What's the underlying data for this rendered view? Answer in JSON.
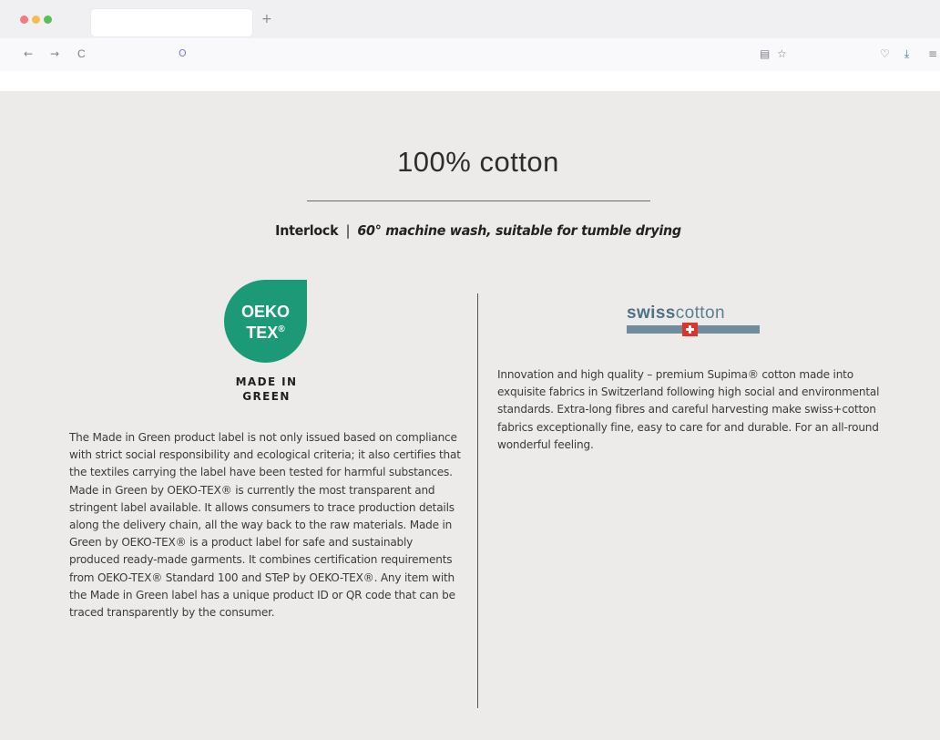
{
  "browser": {
    "new_tab_symbol": "+",
    "nav": {
      "back_icon": "←",
      "forward_icon": "→",
      "reload_icon": "C",
      "shield_icon": "O",
      "reader_icon": "▤",
      "bookmark_icon": "☆",
      "pocket_icon": "♡",
      "download_icon": "⤓",
      "menu_icon": "≡"
    }
  },
  "page": {
    "title": "100% cotton",
    "subtitle": {
      "fabric": "Interlock",
      "separator": "|",
      "care": "60° machine wash, suitable for tumble drying"
    },
    "oeko": {
      "badge_line1": "OEKO",
      "badge_line2": "TEX",
      "badge_reg": "®",
      "made_in_line1": "MADE IN",
      "made_in_line2": "GREEN",
      "description": "The Made in Green product label is not only issued based on compliance with strict social responsibility and ecological criteria; it also certifies that the textiles carrying the label have been tested for harmful substances. Made in Green by OEKO-TEX® is currently the most transparent and stringent label available. It allows consumers to trace production details along the delivery chain, all the way back to the raw materials. Made in Green by OEKO-TEX® is a product label for safe and sustainably produced ready-made garments. It combines certification requirements from OEKO-TEX® Standard 100 and STeP by OEKO-TEX®. Any item with the Made in Green label has a unique product ID or QR code that can be traced transparently by the consumer."
    },
    "swisscotton": {
      "logo_bold": "swiss",
      "logo_light": "cotton",
      "description": "Innovation and high quality – premium Supima® cotton made into exquisite fabrics in Switzerland following high social and environmental standards. Extra-long fibres and careful harvesting make swiss+cotton fabrics exceptionally fine, easy to care for and durable. For an all-round wonderful feeling."
    },
    "colors": {
      "oeko_green": "#1c9a78",
      "swiss_blue": "#5d7f95",
      "swiss_red": "#e1332c"
    }
  }
}
